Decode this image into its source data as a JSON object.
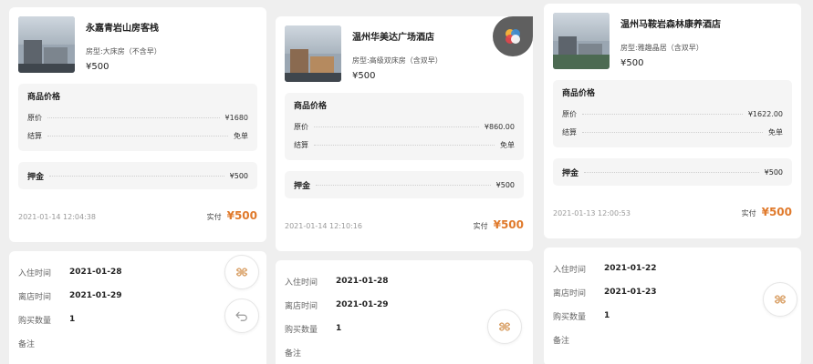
{
  "orders": [
    {
      "hotel_name": "永嘉青岩山房客栈",
      "room_type": "房型:大床房（不含早）",
      "unit_price": "¥500",
      "price_section_title": "商品价格",
      "original_label": "原价",
      "original_value": "¥1680",
      "settle_label": "结算",
      "settle_value": "免单",
      "deposit_label": "押金",
      "deposit_value": "¥500",
      "timestamp": "2021-01-14 12:04:38",
      "paid_label": "实付",
      "paid_amount": "¥500",
      "checkin_label": "入住时间",
      "checkin_value": "2021-01-28",
      "checkout_label": "离店时间",
      "checkout_value": "2021-01-29",
      "qty_label": "购买数量",
      "qty_value": "1",
      "note_label": "备注"
    },
    {
      "hotel_name": "温州华美达广场酒店",
      "room_type": "房型:高级双床房（含双早）",
      "unit_price": "¥500",
      "price_section_title": "商品价格",
      "original_label": "原价",
      "original_value": "¥860.00",
      "settle_label": "结算",
      "settle_value": "免单",
      "deposit_label": "押金",
      "deposit_value": "¥500",
      "timestamp": "2021-01-14 12:10:16",
      "paid_label": "实付",
      "paid_amount": "¥500",
      "checkin_label": "入住时间",
      "checkin_value": "2021-01-28",
      "checkout_label": "离店时间",
      "checkout_value": "2021-01-29",
      "qty_label": "购买数量",
      "qty_value": "1",
      "note_label": "备注"
    },
    {
      "hotel_name": "温州马鞍岩森林康养酒店",
      "room_type": "房型:雅趣晶居（含双早）",
      "unit_price": "¥500",
      "price_section_title": "商品价格",
      "original_label": "原价",
      "original_value": "¥1622.00",
      "settle_label": "结算",
      "settle_value": "免单",
      "deposit_label": "押金",
      "deposit_value": "¥500",
      "timestamp": "2021-01-13 12:00:53",
      "paid_label": "实付",
      "paid_amount": "¥500",
      "checkin_label": "入住时间",
      "checkin_value": "2021-01-22",
      "checkout_label": "离店时间",
      "checkout_value": "2021-01-23",
      "qty_label": "购买数量",
      "qty_value": "1",
      "note_label": "备注"
    }
  ],
  "icons": {
    "menu_grid": "flower-grid-icon",
    "return": "return-arrow-icon",
    "app_badge": "color-circles-icon"
  },
  "colors": {
    "accent": "#e07a2c",
    "icon": "#d9a066"
  }
}
